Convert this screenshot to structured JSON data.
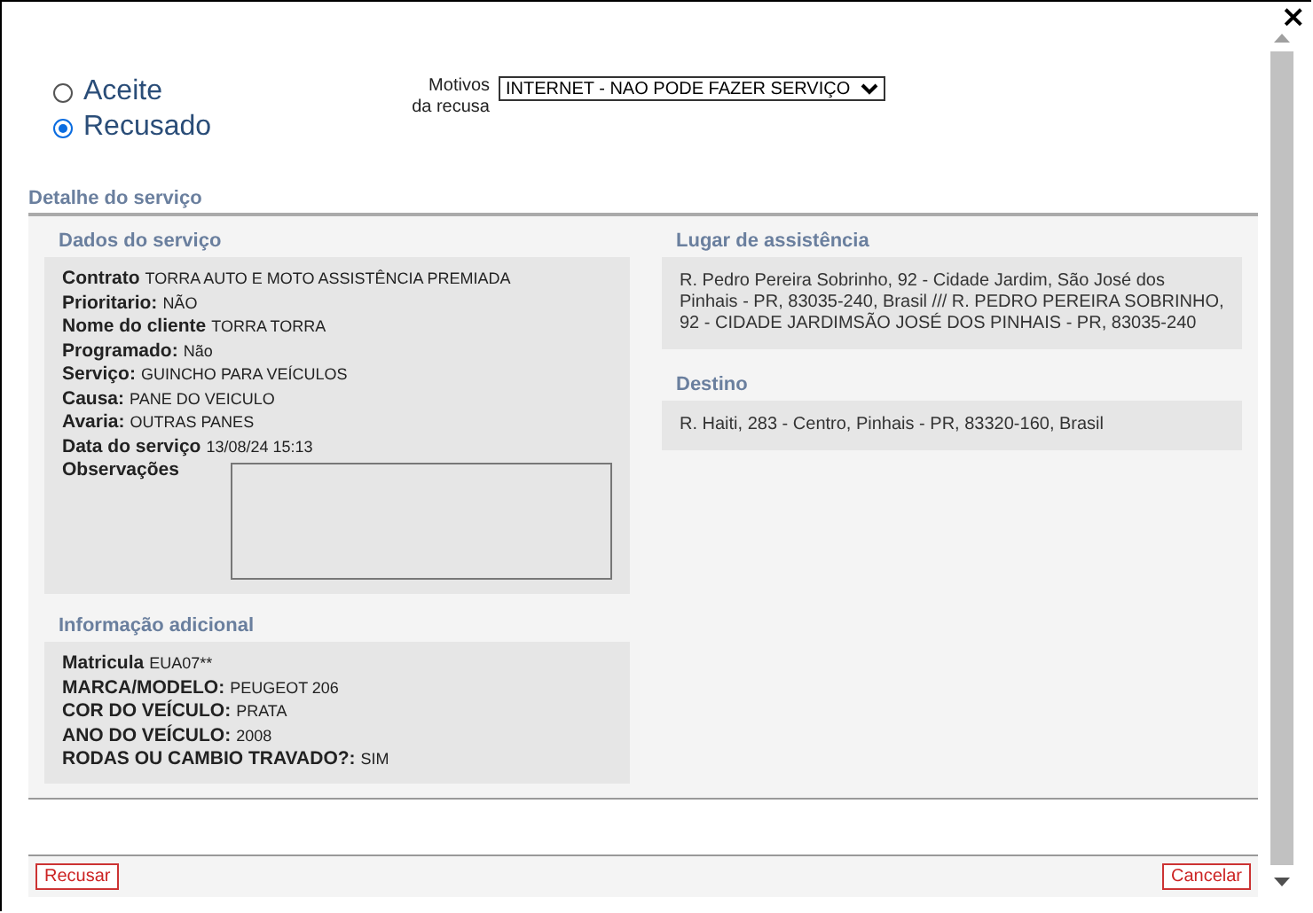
{
  "close_button": "×",
  "decision": {
    "options": [
      {
        "label": "Aceite",
        "selected": false
      },
      {
        "label": "Recusado",
        "selected": true
      }
    ]
  },
  "refusal_reason": {
    "label": "Motivos da recusa",
    "value": "INTERNET - NAO PODE FAZER SERVIÇO"
  },
  "section_title": "Detalhe do serviço",
  "service_data": {
    "title": "Dados do serviço",
    "fields": [
      {
        "label": "Contrato",
        "value": "TORRA AUTO E MOTO ASSISTÊNCIA PREMIADA"
      },
      {
        "label": "Prioritario:",
        "value": "NÃO"
      },
      {
        "label": "Nome do cliente",
        "value": "TORRA TORRA"
      },
      {
        "label": "Programado:",
        "value": "Não"
      },
      {
        "label": "Serviço:",
        "value": "GUINCHO PARA VEÍCULOS"
      },
      {
        "label": "Causa:",
        "value": "PANE DO VEICULO"
      },
      {
        "label": "Avaria:",
        "value": "OUTRAS PANES"
      },
      {
        "label": "Data do serviço",
        "value": "13/08/24 15:13"
      }
    ],
    "notes_label": "Observações"
  },
  "additional_info": {
    "title": "Informação adicional",
    "fields": [
      {
        "label": "Matricula",
        "value": "EUA07**"
      },
      {
        "label": "MARCA/MODELO:",
        "value": "PEUGEOT 206"
      },
      {
        "label": "COR DO VEÍCULO:",
        "value": "PRATA"
      },
      {
        "label": "ANO DO VEÍCULO:",
        "value": "2008"
      },
      {
        "label": "RODAS OU CAMBIO TRAVADO?:",
        "value": "SIM"
      }
    ]
  },
  "assistance_location": {
    "title": "Lugar de assistência",
    "text": "R. Pedro Pereira Sobrinho, 92 - Cidade Jardim, São José dos Pinhais - PR, 83035-240, Brasil /// R. PEDRO PEREIRA SOBRINHO, 92 - CIDADE JARDIMSÃO JOSÉ DOS PINHAIS - PR, 83035-240"
  },
  "destination": {
    "title": "Destino",
    "text": "R. Haiti, 283 - Centro, Pinhais - PR, 83320-160, Brasil"
  },
  "buttons": [
    {
      "label": "Recusar"
    },
    {
      "label": "Cancelar"
    }
  ]
}
